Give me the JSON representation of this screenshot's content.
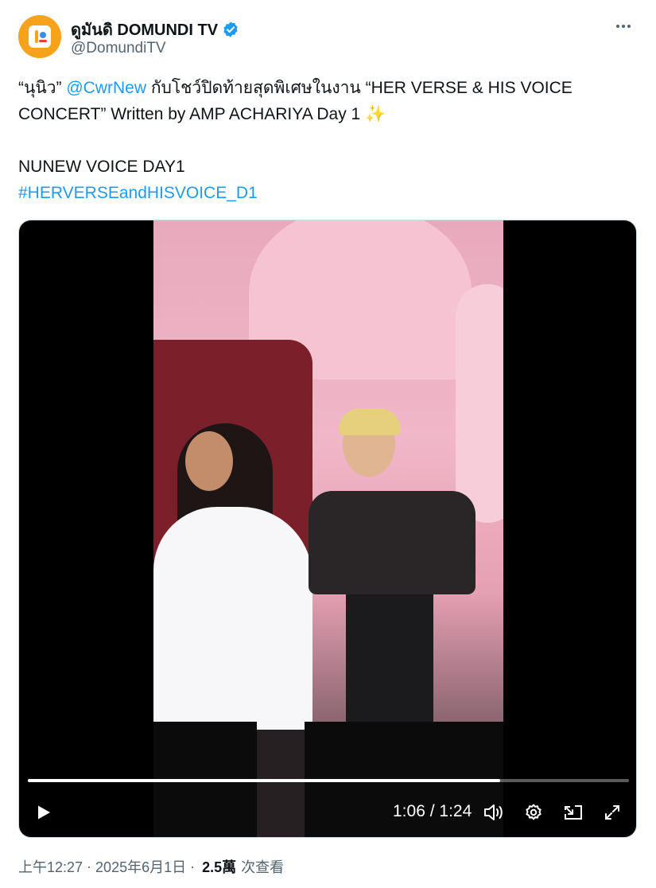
{
  "author": {
    "display_name": "ดูมันดิ DOMUNDI TV",
    "handle": "@DomundiTV",
    "verified": true,
    "avatar_color": "#f7a21b"
  },
  "tweet": {
    "line1_prefix": "“นุนิว” ",
    "mention": "@CwrNew",
    "line1_suffix": " กับโชว์ปิดท้ายสุดพิเศษในงาน “HER VERSE & HIS VOICE",
    "line2": "CONCERT” Written by AMP ACHARIYA Day 1 ✨",
    "line3": "NUNEW VOICE DAY1",
    "hashtag": "#HERVERSEandHISVOICE_D1"
  },
  "video": {
    "current_time": "1:06",
    "separator": " / ",
    "duration": "1:24",
    "progress_fraction": 0.786
  },
  "meta": {
    "time": "上午12:27",
    "date": "2025年6月1日",
    "views_count": "2.5萬",
    "views_label": "次查看"
  },
  "colors": {
    "link": "#1d9bf0",
    "secondary_text": "#536471",
    "primary_text": "#0f1419"
  },
  "icons": [
    "more-icon",
    "verified-icon",
    "play-icon",
    "volume-icon",
    "settings-icon",
    "pip-icon",
    "fullscreen-icon"
  ]
}
